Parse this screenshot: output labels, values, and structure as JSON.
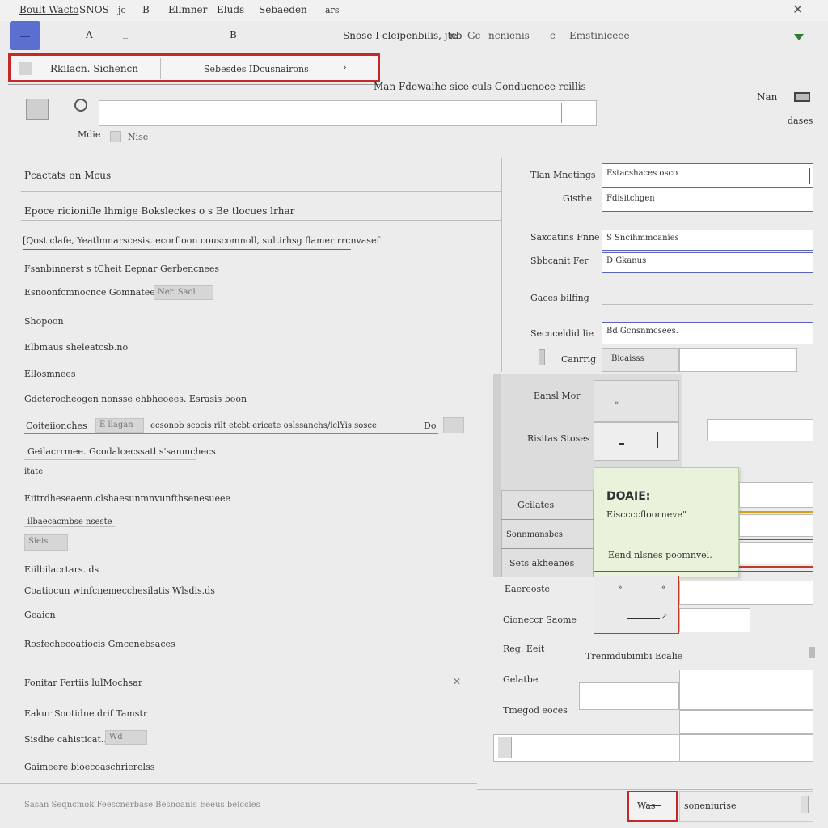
{
  "menu": {
    "items": [
      "Boult Wacto",
      "SNOS",
      "jc",
      "B",
      "Ellmner",
      "Eluds",
      "Sebaeden",
      "ars"
    ],
    "close_glyph": "✕"
  },
  "toolbar": {
    "letter_a": "A",
    "dash": "_",
    "letter_b": "B",
    "center_text": "Snose I cleipenbilis, jte",
    "mid_text": "nb",
    "mid_text2": "Gc",
    "mid_text3": "ncnienis",
    "mid_text4": "c",
    "right_text": "Emstiniceee",
    "accent_color": "#2e7d32"
  },
  "tabbar": {
    "left_label": "Rkilacn. Sichencn",
    "right_label": "Sebesdes IDcusnairons",
    "arrow": "›",
    "border_color": "#c62828"
  },
  "header": {
    "caption": "Man Fdewaihe sice culs Conducnoce rcillis",
    "top_right_label": "Nan",
    "top_right_sub": "dases",
    "entry_label": "Nise",
    "entry_prefix": "Mdie"
  },
  "left": {
    "section_title": "Pcactats on Mcus",
    "subheader": "Epoce ricionifle lhmige Boksleckes o s Be tlocues lrhar",
    "selected_row": "[Qost clafe, Yeatlmnarscesis. ecorf oon couscomnoll, sultirhsg flamer rrcnvasef",
    "rows": [
      "Fsanbinnerst s tCheit Eepnar Gerbencnees",
      "Esnoonfcmnocnce Gomnatees.ck",
      "Shopoon",
      "Elbmaus sheleatcsb.no",
      "Ellosmnees",
      "Gdcterocheogen nonsse ehbheoees. Esrasis boon",
      "Coiteiionches",
      "Geilacrrmee. Gcodalcecssatl s'sanmchecs",
      "itate",
      "Eiitrdheseaenn.clshaesunmnvunfthsenesueee",
      "ilbaecacmbse nseste",
      "Eiilbilacrtars. ds",
      "Coatiocun winfcnemecchesilatis Wlsdis.ds",
      "Geaicn",
      "Rosfechecoatiocis Gmcenebsaces"
    ],
    "chip_1": "Ner. Saol",
    "chip_2": "E llagan",
    "mid_long": "ecsonob scocis rilt etcbt ericate oslssanchs/iclYis sosce",
    "chip_3": "Do",
    "chip_4": "Sieis",
    "section2_title": "Fonitar  Fertiis lulMochsar",
    "section2_rows": [
      "Eakur Sootidne drif Tamstr",
      "Sisdhe cahisticat..",
      "Gaimeere bioecoaschrierelss"
    ],
    "chip_5": "Wd",
    "close_glyph": "✕",
    "footer_text": "Sasan Seqncmok Feescnerbase Besnoanis Eeeus beiccies"
  },
  "right": {
    "fields": [
      {
        "label": "Tlan Mnetings",
        "value": "Estacshaces osco"
      },
      {
        "label": "Gisthe",
        "value": "Fdisitchgen"
      },
      {
        "label": "Saxcatins Fnne",
        "value": "S Sncihmmcanies"
      },
      {
        "label": "Sbbcanit Fer",
        "value": "D Gkanus"
      },
      {
        "label": "Gaces bilfing",
        "value": ""
      },
      {
        "label": "Secnceldid lie",
        "value": "Bd Gcnsnmcsees."
      },
      {
        "label": "Canrrig",
        "value": "Bicaisss"
      }
    ],
    "panel_title": "Eansl Mor",
    "panel_sub": "Risitas Stoses",
    "panel_items": [
      "Gcilates",
      "Sonnmansbcs",
      "Sets akheanes"
    ],
    "popup": {
      "title": "DOAIE:",
      "subtitle": "Eisccccfloorneve\"",
      "body": "Eend nlsnes poomnvel.",
      "bg_color": "#e9f3dc"
    },
    "lower_labels": [
      "Eaereoste",
      "Cioneccr Saome",
      "Reg. Eeit",
      "Gelatbe",
      "Tmegod eoces"
    ],
    "lower_right_label": "Trenmdubinibi Ecalie",
    "status_left": "Was",
    "status_right": "soneniurise",
    "status_border": "#c62828"
  }
}
